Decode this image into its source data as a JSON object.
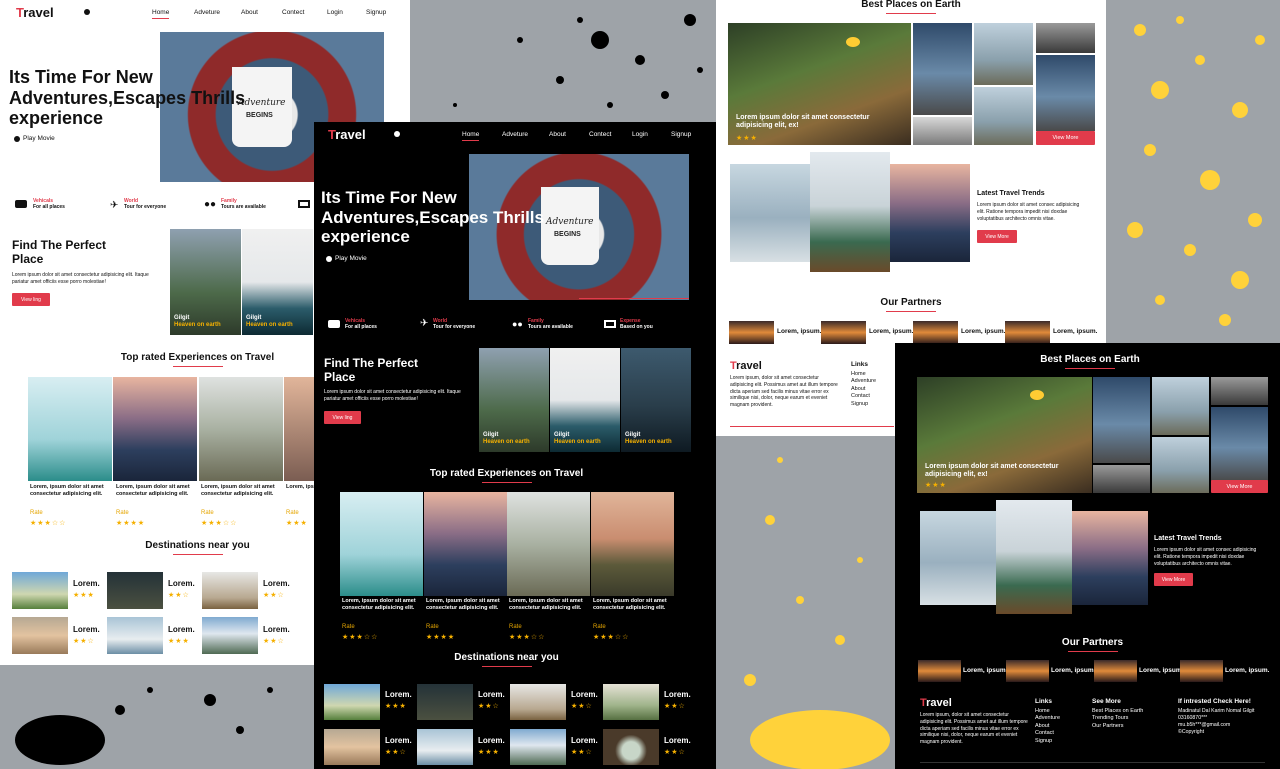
{
  "brand": {
    "initial": "T",
    "rest": "ravel"
  },
  "nav": [
    "Home",
    "Adveture",
    "About",
    "Contect",
    "Login",
    "Signup"
  ],
  "hero": {
    "line1": "Its Time For New",
    "line2": "Adventures,Escapes Thrills",
    "line3": "experience",
    "play": "Play Movie",
    "mug_word": "Adventure",
    "mug_sub": "BEGINS"
  },
  "features": [
    {
      "title": "Vehicals",
      "sub": "For all places",
      "icon": "car-icon"
    },
    {
      "title": "World",
      "sub": "Tour for everyone",
      "icon": "plane-icon"
    },
    {
      "title": "Family",
      "sub": "Tours are available",
      "icon": "users-icon"
    },
    {
      "title": "Expense",
      "sub": "Based on you",
      "icon": "money-icon"
    }
  ],
  "find": {
    "title1": "Find The Perfect",
    "title2": "Place",
    "text": "Lorem ipsum dolor sit amet consectetur adipisicing elit. Itaque pariatur amet officiis esse porro molestiae!",
    "button": "View ling"
  },
  "place_cards": [
    {
      "name": "Gilgit",
      "sub": "Heaven on earth"
    },
    {
      "name": "Gilgit",
      "sub": "Heaven on earth"
    },
    {
      "name": "Gilgit",
      "sub": "Heaven on earth"
    }
  ],
  "top_rated": {
    "title": "Top rated Experiences on Travel",
    "card_text": "Lorem, ipsum dolor sit amet consectetur adipisicing elit.",
    "rate": "Rate"
  },
  "destinations": {
    "title": "Destinations near you",
    "item": "Lorem.",
    "stars_full": "★★★",
    "stars_half": "★★☆"
  },
  "best": {
    "title": "Best Places on Earth",
    "caption": "Lorem ipsum dolor sit amet consectetur adipisicing elit, ex!",
    "button": "View More"
  },
  "trends": {
    "title": "Latest Travel Trends",
    "text": "Lorem ipsum dolor sit amet consec adipisicing elit. Ratione tempora impedit nisi doxdae voluptatibus architecto omnis vitae.",
    "button": "View More"
  },
  "partners": {
    "title": "Our Partners",
    "item": "Lorem, ipsum."
  },
  "footer": {
    "about": "Lorem ipsum, dolor sit amet consectetur adipisicing elit. Possimus amet aut illum tempore dicta aperiam sed facilis minus vitae error ex similique nisi, dolor, neque earum et eveniet magnam provident.",
    "links_title": "Links",
    "links": [
      "Home",
      "Adventure",
      "About",
      "Contact",
      "Signup"
    ],
    "see_title": "See More",
    "see": [
      "Best Places on Earth",
      "Trending Tours",
      "Our Partners"
    ],
    "check_title": "If intrested Check Here!",
    "check": [
      "Madinatul Dal Karim Nomal Gilgit",
      "03160870***",
      "mu.b5h***@gmail.com",
      "©Copyright"
    ]
  },
  "stars": {
    "three": "★★★",
    "three_half": "★★☆",
    "four": "★★★★",
    "three_of_five": "★★★☆☆",
    "four_of_five": "★★★★☆"
  },
  "colors": {
    "accent": "#e13b4b",
    "star": "#f5b000",
    "bg_gray": "#9ea3a8",
    "splash_yellow": "#ffd23a"
  }
}
